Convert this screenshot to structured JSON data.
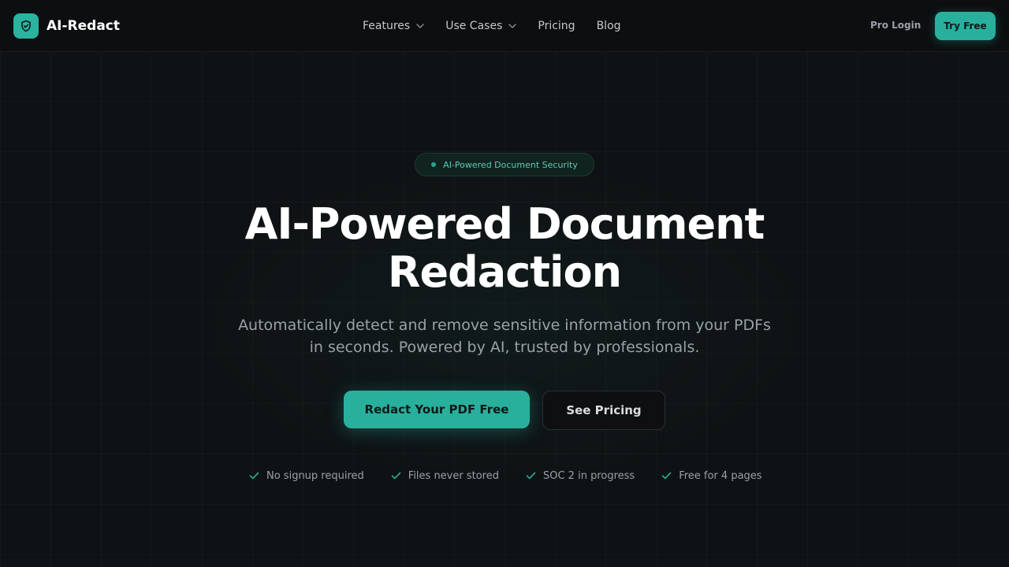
{
  "brand": {
    "name": "AI-Redact",
    "icon": "shield-check-icon",
    "accent": "#29b09d"
  },
  "nav": {
    "links": [
      {
        "label": "Features",
        "dropdown": true
      },
      {
        "label": "Use Cases",
        "dropdown": true
      },
      {
        "label": "Pricing",
        "dropdown": false
      },
      {
        "label": "Blog",
        "dropdown": false
      }
    ],
    "pro_login": "Pro Login",
    "try_free": "Try Free"
  },
  "hero": {
    "badge": "AI-Powered Document Security",
    "title_line1": "AI-Powered Document",
    "title_line2": "Redaction",
    "subtitle_line1": "Automatically detect and remove sensitive information from your PDFs",
    "subtitle_line2": "in seconds. Powered by AI, trusted by professionals.",
    "primary_cta": "Redact Your PDF Free",
    "secondary_cta": "See Pricing",
    "features": [
      "No signup required",
      "Files never stored",
      "SOC 2 in progress",
      "Free for 4 pages"
    ]
  },
  "colors": {
    "background": "#0f1214",
    "accent": "#29b09d",
    "text_muted": "#9aa1a7"
  }
}
